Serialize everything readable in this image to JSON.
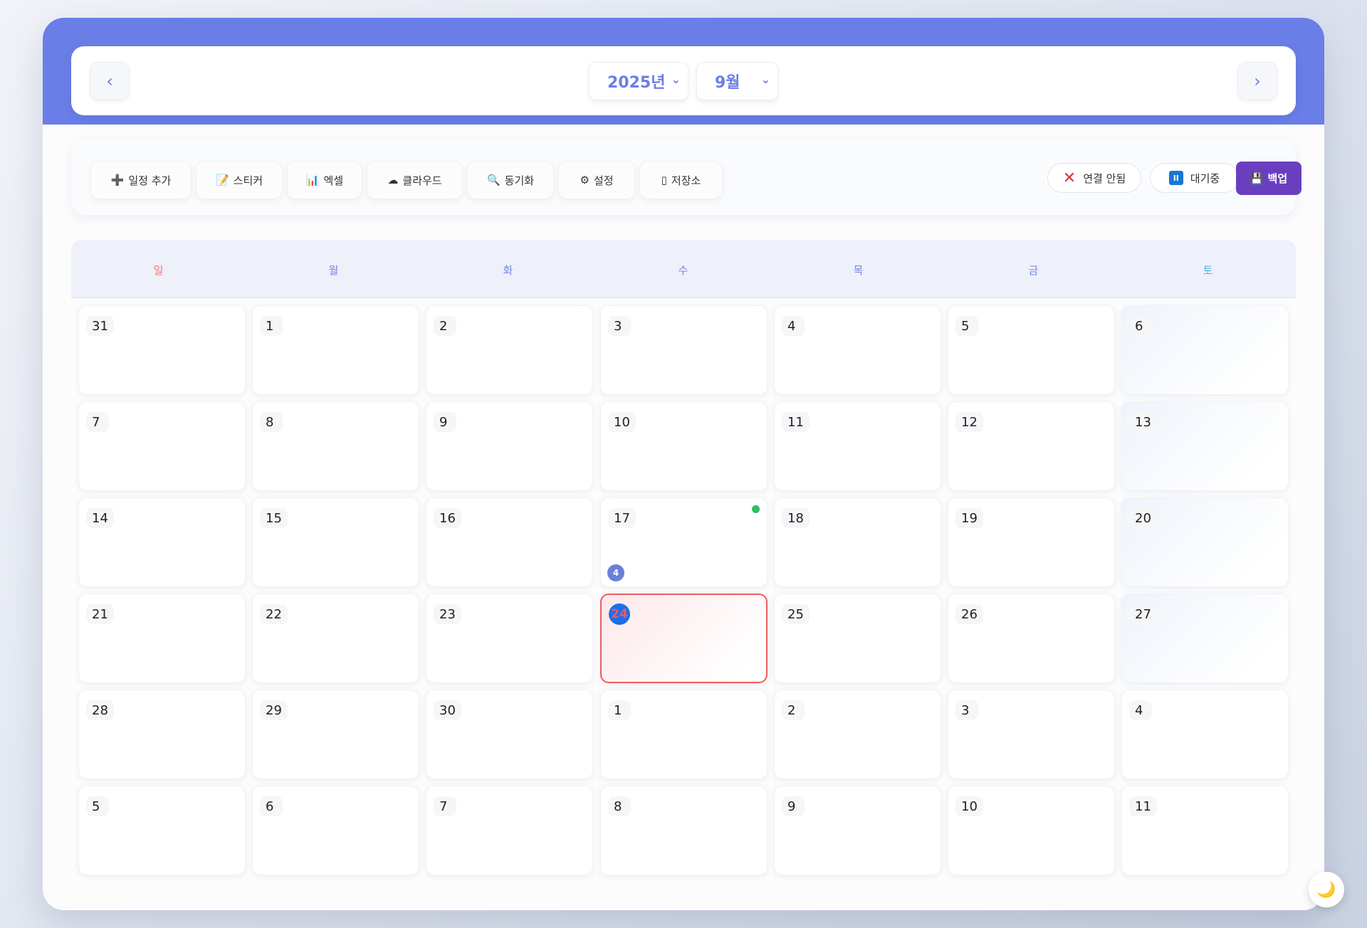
{
  "header": {
    "prev": "‹",
    "next": "›",
    "year": "2025년",
    "month": "9월",
    "chevron": "⌄"
  },
  "toolbar": {
    "buttons": [
      {
        "icon": "➕",
        "label": "일정 추가"
      },
      {
        "icon": "📝",
        "label": "스티커"
      },
      {
        "icon": "📊",
        "label": "엑셀"
      },
      {
        "icon": "☁",
        "label": "클라우드"
      },
      {
        "icon": "🔍",
        "label": "동기화"
      },
      {
        "icon": "⚙",
        "label": "설정"
      },
      {
        "icon": "▯",
        "label": "저장소"
      }
    ],
    "status": [
      {
        "icon": "✕",
        "label": "연결 안됨"
      },
      {
        "icon": "II",
        "label": "대기중"
      }
    ],
    "backup": {
      "icon": "💾",
      "label": "백업"
    }
  },
  "weekdays": [
    "일",
    "월",
    "화",
    "수",
    "목",
    "금",
    "토"
  ],
  "calendar": {
    "today": 24,
    "event_dot_day": 17,
    "event_count_day": 17,
    "event_count": "4",
    "event_dot_color": "#2bc060",
    "today_color": "#ef5d5d",
    "weeks": [
      [
        31,
        1,
        2,
        3,
        4,
        5,
        6
      ],
      [
        7,
        8,
        9,
        10,
        11,
        12,
        13
      ],
      [
        14,
        15,
        16,
        17,
        18,
        19,
        20
      ],
      [
        21,
        22,
        23,
        24,
        25,
        26,
        27
      ],
      [
        28,
        29,
        30,
        1,
        2,
        3,
        4
      ],
      [
        5,
        6,
        7,
        8,
        9,
        10,
        11
      ]
    ]
  },
  "theme_toggle": "🌙",
  "colors": {
    "accent": "#6a7ee8",
    "backup": "#6a3fbf",
    "sunday": "#f07670",
    "saturday": "#3fbde8"
  }
}
